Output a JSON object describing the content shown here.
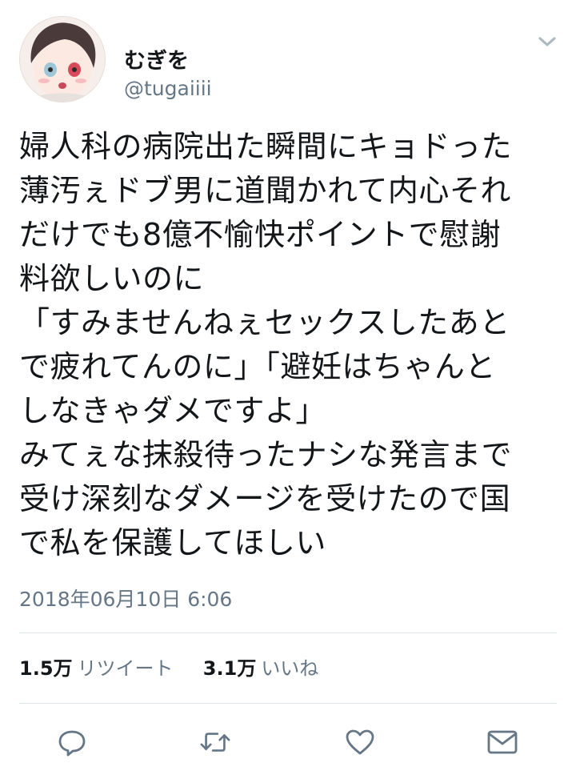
{
  "tweet": {
    "user": {
      "display_name": "むぎを",
      "handle": "@tugaiiii"
    },
    "text_lines": [
      "婦人科の病院出た瞬間にキョドった",
      "薄汚ぇドブ男に道聞かれて内心それ",
      "だけでも8億不愉快ポイントで慰謝",
      "料欲しいのに",
      "「すみませんねぇセックスしたあと",
      "で疲れてんのに」「避妊はちゃんと",
      "しなきゃダメですよ」",
      "みてぇな抹殺待ったナシな発言まで",
      "受け深刻なダメージを受けたので国",
      "で私を保護してほしい"
    ],
    "timestamp": "2018年06月10日 6:06",
    "stats": {
      "retweet_count": "1.5万",
      "retweet_label": "リツイート",
      "like_count": "3.1万",
      "like_label": "いいね"
    },
    "icons": {
      "menu": "chevron-down-icon",
      "reply": "reply-icon",
      "retweet": "retweet-icon",
      "like": "heart-icon",
      "dm": "mail-icon"
    },
    "colors": {
      "text": "#14171a",
      "secondary": "#657786",
      "icon": "#657786",
      "divider": "#e1e8ed"
    }
  }
}
